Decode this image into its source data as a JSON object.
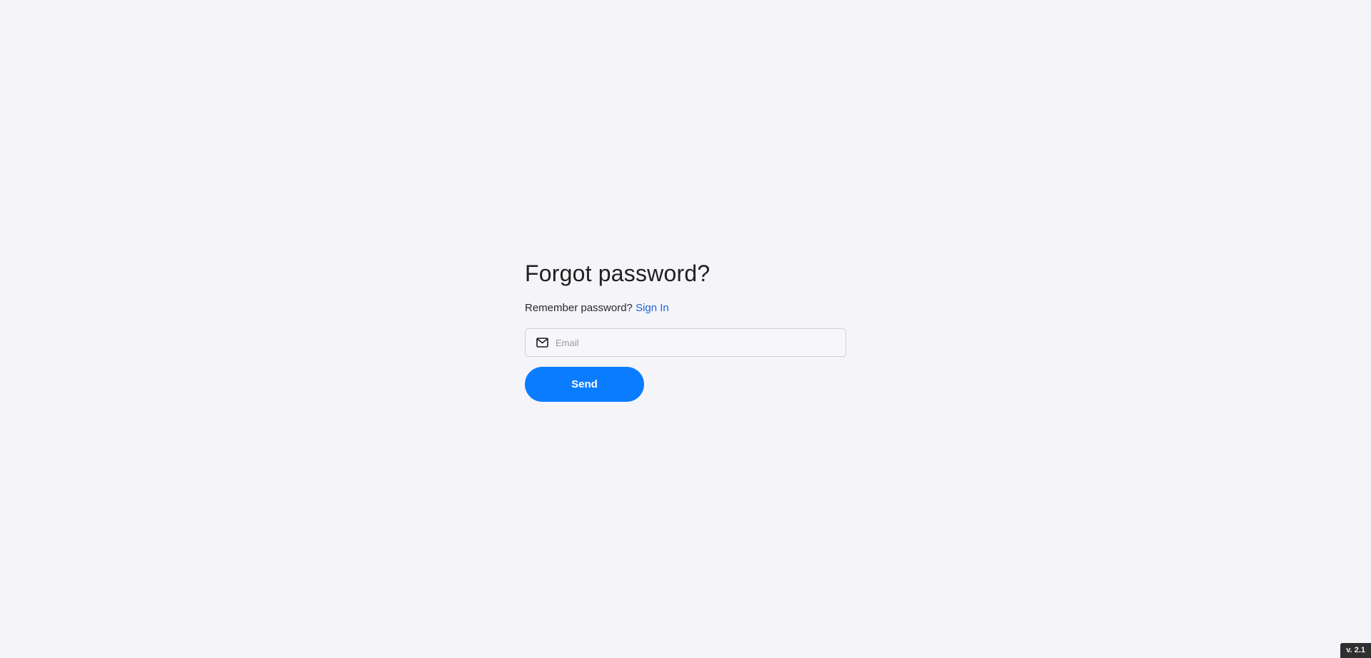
{
  "form": {
    "title": "Forgot password?",
    "remember_text": "Remember password?",
    "sign_in_link": "Sign In",
    "email": {
      "placeholder": "Email",
      "value": "",
      "icon": "mail-icon"
    },
    "send_label": "Send"
  },
  "footer": {
    "version": "v. 2.1"
  },
  "colors": {
    "background": "#f4f4f9",
    "accent": "#0a7cff",
    "link": "#1f63d8"
  }
}
